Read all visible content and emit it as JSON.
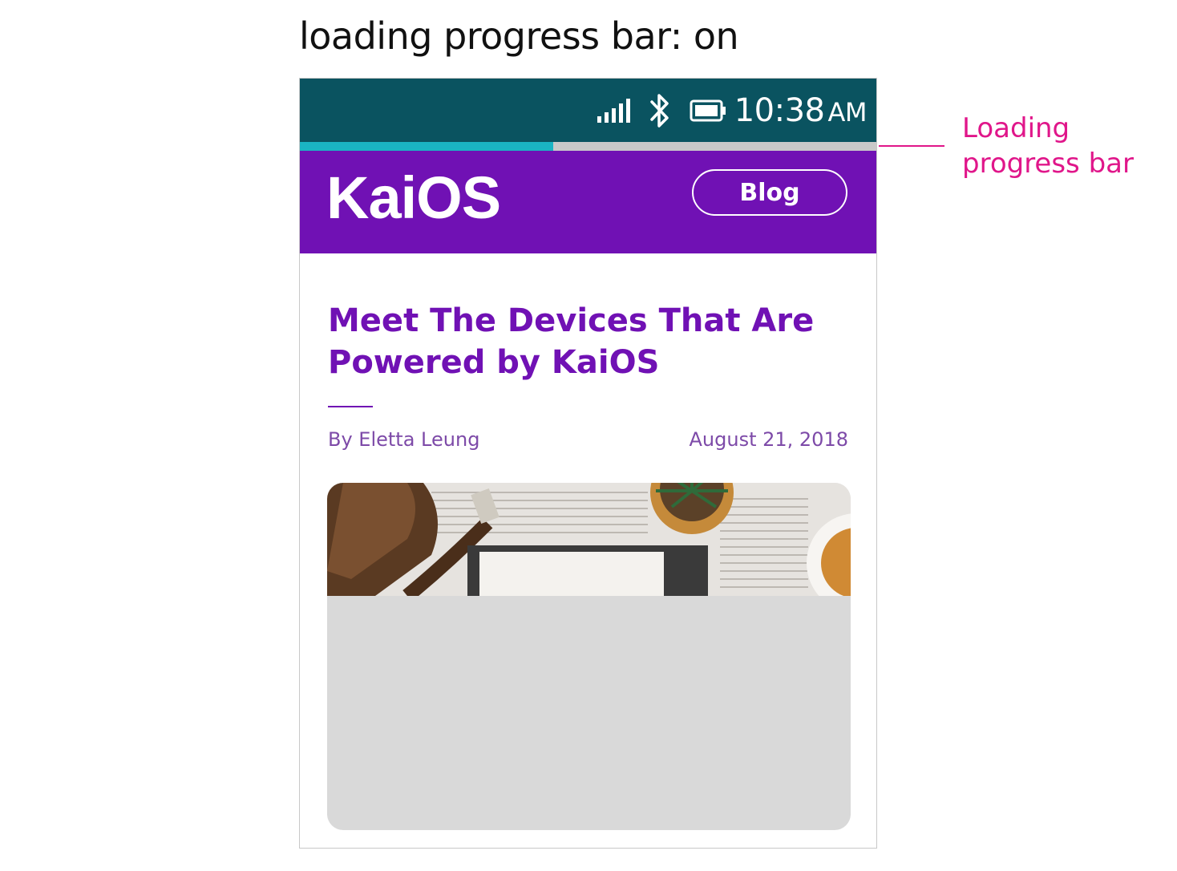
{
  "page": {
    "title": "loading progress bar: on"
  },
  "status_bar": {
    "time": "10:38",
    "ampm": "AM",
    "icons": [
      "signal-icon",
      "bluetooth-icon",
      "battery-icon"
    ],
    "background_color": "#0a5360"
  },
  "progress_bar": {
    "progress": 0.44,
    "fill_color": "#1ab4c3",
    "track_color": "#c9c9c9"
  },
  "header": {
    "logo": "KaiOS",
    "blog_button": "Blog",
    "background_color": "#7011b4"
  },
  "article": {
    "title": "Meet The Devices That Are Powered by KaiOS",
    "author": "By Eletta Leung",
    "date": "August 21, 2018",
    "accent_color": "#7011b4"
  },
  "annotation": {
    "line1": "Loading",
    "line2": "progress bar",
    "color": "#e0168a"
  }
}
